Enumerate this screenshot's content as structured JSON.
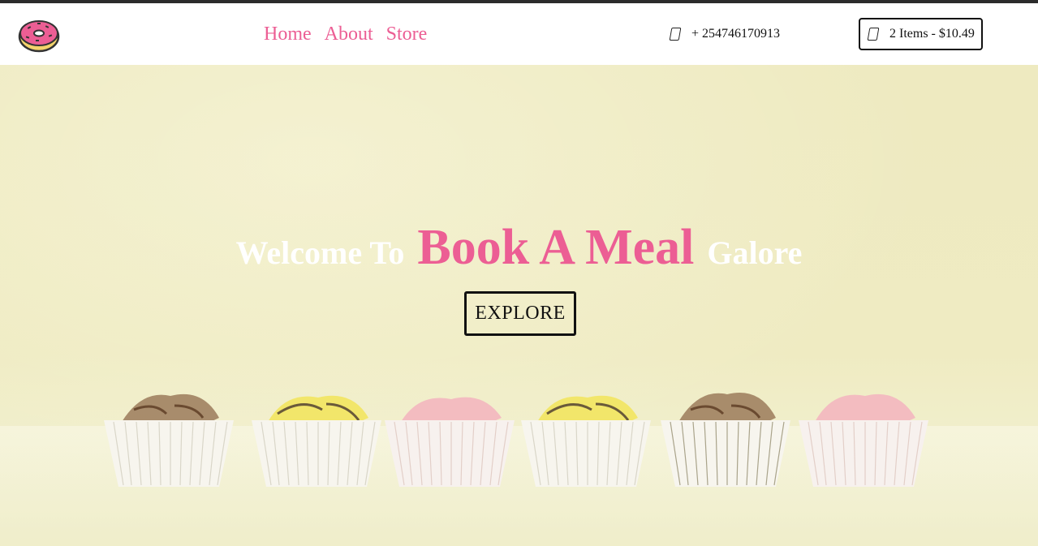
{
  "header": {
    "nav": [
      {
        "label": "Home"
      },
      {
        "label": "About"
      },
      {
        "label": "Store"
      }
    ],
    "phone": {
      "icon": "phone-icon",
      "number": "+ 254746170913"
    },
    "cart": {
      "icon": "cart-icon",
      "label": "2 Items - $10.49"
    },
    "logo": {
      "icon": "donut-logo-icon"
    }
  },
  "hero": {
    "welcome": "Welcome To",
    "brand": "Book A Meal",
    "suffix": "Galore",
    "cta": "EXPLORE"
  },
  "colors": {
    "accent": "#ec5e94",
    "hero_bg": "#eeeac0",
    "text_dark": "#111111"
  }
}
